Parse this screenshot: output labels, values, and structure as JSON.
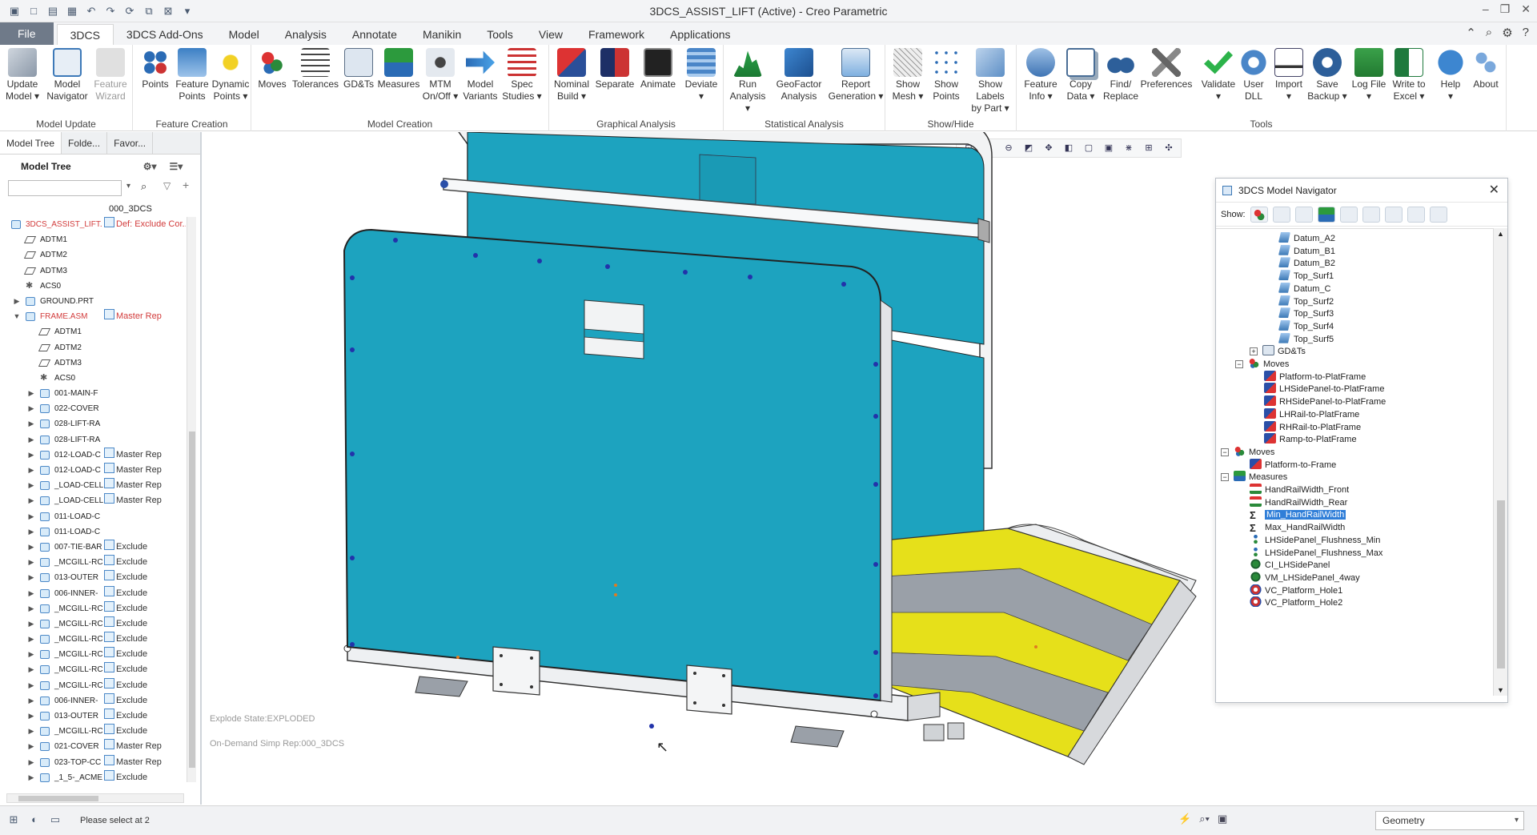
{
  "window": {
    "title": "3DCS_ASSIST_LIFT (Active) - Creo Parametric",
    "quick_access": [
      "app-icon",
      "new-icon",
      "open-icon",
      "save-icon",
      "undo-icon",
      "redo-icon",
      "regenerate-icon",
      "windows-icon",
      "close-window-icon",
      "customize-icon"
    ],
    "controls": [
      "minimize-icon",
      "restore-icon",
      "close-icon"
    ]
  },
  "tabs": [
    {
      "label": "File"
    },
    {
      "label": "3DCS"
    },
    {
      "label": "3DCS Add-Ons"
    },
    {
      "label": "Model"
    },
    {
      "label": "Analysis"
    },
    {
      "label": "Annotate"
    },
    {
      "label": "Manikin"
    },
    {
      "label": "Tools"
    },
    {
      "label": "View"
    },
    {
      "label": "Framework"
    },
    {
      "label": "Applications"
    }
  ],
  "ribbon": {
    "groups": [
      {
        "name": "Model Update",
        "buttons": [
          {
            "label": "Update\nModel ▾"
          },
          {
            "label": "Model\nNavigator"
          },
          {
            "label": "Feature\nWizard"
          }
        ]
      },
      {
        "name": "Feature Creation",
        "buttons": [
          {
            "label": "Points"
          },
          {
            "label": "Feature\nPoints"
          },
          {
            "label": "Dynamic\nPoints ▾"
          }
        ]
      },
      {
        "name": "Model Creation",
        "buttons": [
          {
            "label": "Moves"
          },
          {
            "label": "Tolerances"
          },
          {
            "label": "GD&Ts"
          },
          {
            "label": "Measures"
          },
          {
            "label": "MTM\nOn/Off ▾"
          },
          {
            "label": "Model\nVariants"
          },
          {
            "label": "Spec\nStudies ▾"
          }
        ]
      },
      {
        "name": "Graphical Analysis",
        "buttons": [
          {
            "label": "Nominal\nBuild ▾"
          },
          {
            "label": "Separate"
          },
          {
            "label": "Animate"
          },
          {
            "label": "Deviate\n▾"
          }
        ]
      },
      {
        "name": "Statistical Analysis",
        "buttons": [
          {
            "label": "Run\nAnalysis ▾"
          },
          {
            "label": "GeoFactor\nAnalysis"
          },
          {
            "label": "Report\nGeneration ▾"
          }
        ]
      },
      {
        "name": "Show/Hide",
        "buttons": [
          {
            "label": "Show\nMesh ▾"
          },
          {
            "label": "Show\nPoints"
          },
          {
            "label": "Show Labels\nby Part ▾"
          }
        ]
      },
      {
        "name": "Tools",
        "buttons": [
          {
            "label": "Feature\nInfo ▾"
          },
          {
            "label": "Copy\nData ▾"
          },
          {
            "label": "Find/\nReplace"
          },
          {
            "label": "Preferences"
          },
          {
            "label": "Validate\n▾"
          },
          {
            "label": "User\nDLL"
          },
          {
            "label": "Import\n▾"
          },
          {
            "label": "Save\nBackup ▾"
          },
          {
            "label": "Log File\n▾"
          },
          {
            "label": "Write to\nExcel ▾"
          },
          {
            "label": "Help\n▾"
          },
          {
            "label": "About"
          }
        ]
      }
    ]
  },
  "left_panel": {
    "tabs": [
      {
        "label": "Model Tree"
      },
      {
        "label": "Folde..."
      },
      {
        "label": "Favor..."
      }
    ],
    "header": "Model Tree",
    "column_header": "000_3DCS",
    "rows": [
      {
        "name": "3DCS_ASSIST_LIFT.",
        "rep": "Def: Exclude Cor...",
        "level": 0,
        "expand": "",
        "type": "asm",
        "red": true,
        "repred": true
      },
      {
        "name": "ADTM1",
        "rep": "",
        "level": 1,
        "expand": "",
        "type": "datum"
      },
      {
        "name": "ADTM2",
        "rep": "",
        "level": 1,
        "expand": "",
        "type": "datum"
      },
      {
        "name": "ADTM3",
        "rep": "",
        "level": 1,
        "expand": "",
        "type": "datum"
      },
      {
        "name": "ACS0",
        "rep": "",
        "level": 1,
        "expand": "",
        "type": "csys"
      },
      {
        "name": "GROUND.PRT",
        "rep": "",
        "level": 1,
        "expand": "▶",
        "type": "part"
      },
      {
        "name": "FRAME.ASM",
        "rep": "Master Rep",
        "level": 1,
        "expand": "▼",
        "type": "asm",
        "red": true,
        "repred": true
      },
      {
        "name": "ADTM1",
        "rep": "",
        "level": 2,
        "expand": "",
        "type": "datum"
      },
      {
        "name": "ADTM2",
        "rep": "",
        "level": 2,
        "expand": "",
        "type": "datum"
      },
      {
        "name": "ADTM3",
        "rep": "",
        "level": 2,
        "expand": "",
        "type": "datum"
      },
      {
        "name": "ACS0",
        "rep": "",
        "level": 2,
        "expand": "",
        "type": "csys"
      },
      {
        "name": "001-MAIN-F",
        "rep": "",
        "level": 2,
        "expand": "▶",
        "type": "part"
      },
      {
        "name": "022-COVER",
        "rep": "",
        "level": 2,
        "expand": "▶",
        "type": "part"
      },
      {
        "name": "028-LIFT-RA",
        "rep": "",
        "level": 2,
        "expand": "▶",
        "type": "part"
      },
      {
        "name": "028-LIFT-RA",
        "rep": "",
        "level": 2,
        "expand": "▶",
        "type": "part"
      },
      {
        "name": "012-LOAD-C",
        "rep": "Master Rep",
        "level": 2,
        "expand": "▶",
        "type": "part"
      },
      {
        "name": "012-LOAD-C",
        "rep": "Master Rep",
        "level": 2,
        "expand": "▶",
        "type": "part"
      },
      {
        "name": "_LOAD-CELL",
        "rep": "Master Rep",
        "level": 2,
        "expand": "▶",
        "type": "part"
      },
      {
        "name": "_LOAD-CELL",
        "rep": "Master Rep",
        "level": 2,
        "expand": "▶",
        "type": "part"
      },
      {
        "name": "011-LOAD-C",
        "rep": "",
        "level": 2,
        "expand": "▶",
        "type": "part"
      },
      {
        "name": "011-LOAD-C",
        "rep": "",
        "level": 2,
        "expand": "▶",
        "type": "part"
      },
      {
        "name": "007-TIE-BAR",
        "rep": "Exclude",
        "level": 2,
        "expand": "▶",
        "type": "part"
      },
      {
        "name": "_MCGILL-RC",
        "rep": "Exclude",
        "level": 2,
        "expand": "▶",
        "type": "part"
      },
      {
        "name": "013-OUTER",
        "rep": "Exclude",
        "level": 2,
        "expand": "▶",
        "type": "part"
      },
      {
        "name": "006-INNER-",
        "rep": "Exclude",
        "level": 2,
        "expand": "▶",
        "type": "part"
      },
      {
        "name": "_MCGILL-RC",
        "rep": "Exclude",
        "level": 2,
        "expand": "▶",
        "type": "part"
      },
      {
        "name": "_MCGILL-RC",
        "rep": "Exclude",
        "level": 2,
        "expand": "▶",
        "type": "part"
      },
      {
        "name": "_MCGILL-RC",
        "rep": "Exclude",
        "level": 2,
        "expand": "▶",
        "type": "part"
      },
      {
        "name": "_MCGILL-RC",
        "rep": "Exclude",
        "level": 2,
        "expand": "▶",
        "type": "part"
      },
      {
        "name": "_MCGILL-RC",
        "rep": "Exclude",
        "level": 2,
        "expand": "▶",
        "type": "part"
      },
      {
        "name": "_MCGILL-RC",
        "rep": "Exclude",
        "level": 2,
        "expand": "▶",
        "type": "part"
      },
      {
        "name": "006-INNER-",
        "rep": "Exclude",
        "level": 2,
        "expand": "▶",
        "type": "part"
      },
      {
        "name": "013-OUTER",
        "rep": "Exclude",
        "level": 2,
        "expand": "▶",
        "type": "part"
      },
      {
        "name": "_MCGILL-RC",
        "rep": "Exclude",
        "level": 2,
        "expand": "▶",
        "type": "part"
      },
      {
        "name": "021-COVER",
        "rep": "Master Rep",
        "level": 2,
        "expand": "▶",
        "type": "part"
      },
      {
        "name": "023-TOP-CC",
        "rep": "Master Rep",
        "level": 2,
        "expand": "▶",
        "type": "part"
      },
      {
        "name": "_1_5-_ACME",
        "rep": "Exclude",
        "level": 2,
        "expand": "▶",
        "type": "part"
      }
    ]
  },
  "viewport": {
    "explode_state": "Explode State:EXPLODED",
    "simp_rep": "On-Demand Simp Rep:000_3DCS",
    "toolbar": [
      "refit-icon",
      "zoom-in-icon",
      "zoom-out-icon",
      "repaint-icon",
      "pan-icon",
      "display-style-icon",
      "named-views-icon",
      "section-icon",
      "datum-display-icon",
      "annotation-display-icon",
      "spin-center-icon"
    ]
  },
  "navigator": {
    "title": "3DCS Model Navigator",
    "show_label": "Show:",
    "show_icons": 9,
    "rows": [
      {
        "label": "Datum_A2",
        "indent": 3,
        "icon": "plane",
        "expand": ""
      },
      {
        "label": "Datum_B1",
        "indent": 3,
        "icon": "plane",
        "expand": ""
      },
      {
        "label": "Datum_B2",
        "indent": 3,
        "icon": "plane",
        "expand": ""
      },
      {
        "label": "Top_Surf1",
        "indent": 3,
        "icon": "plane",
        "expand": ""
      },
      {
        "label": "Datum_C",
        "indent": 3,
        "icon": "plane",
        "expand": ""
      },
      {
        "label": "Top_Surf2",
        "indent": 3,
        "icon": "plane",
        "expand": ""
      },
      {
        "label": "Top_Surf3",
        "indent": 3,
        "icon": "plane",
        "expand": ""
      },
      {
        "label": "Top_Surf4",
        "indent": 3,
        "icon": "plane",
        "expand": ""
      },
      {
        "label": "Top_Surf5",
        "indent": 3,
        "icon": "plane",
        "expand": ""
      },
      {
        "label": "GD&Ts",
        "indent": 2,
        "icon": "gdt",
        "expand": "+"
      },
      {
        "label": "Moves",
        "indent": 1,
        "icon": "moves",
        "expand": "−"
      },
      {
        "label": "Platform-to-PlatFrame",
        "indent": 2,
        "icon": "move",
        "expand": ""
      },
      {
        "label": "LHSidePanel-to-PlatFrame",
        "indent": 2,
        "icon": "move",
        "expand": ""
      },
      {
        "label": "RHSidePanel-to-PlatFrame",
        "indent": 2,
        "icon": "move",
        "expand": ""
      },
      {
        "label": "LHRail-to-PlatFrame",
        "indent": 2,
        "icon": "move",
        "expand": ""
      },
      {
        "label": "RHRail-to-PlatFrame",
        "indent": 2,
        "icon": "move",
        "expand": ""
      },
      {
        "label": "Ramp-to-PlatFrame",
        "indent": 2,
        "icon": "move",
        "expand": ""
      },
      {
        "label": "Moves",
        "indent": 0,
        "icon": "moves",
        "expand": "−"
      },
      {
        "label": "Platform-to-Frame",
        "indent": 1,
        "icon": "move",
        "expand": ""
      },
      {
        "label": "Measures",
        "indent": 0,
        "icon": "measures",
        "expand": "−"
      },
      {
        "label": "HandRailWidth_Front",
        "indent": 1,
        "icon": "measure",
        "expand": ""
      },
      {
        "label": "HandRailWidth_Rear",
        "indent": 1,
        "icon": "measure",
        "expand": ""
      },
      {
        "label": "Min_HandRailWidth",
        "indent": 1,
        "icon": "sigma",
        "expand": "",
        "selected": true
      },
      {
        "label": "Max_HandRailWidth",
        "indent": 1,
        "icon": "sigma",
        "expand": ""
      },
      {
        "label": "LHSidePanel_Flushness_Min",
        "indent": 1,
        "icon": "dots",
        "expand": ""
      },
      {
        "label": "LHSidePanel_Flushness_Max",
        "indent": 1,
        "icon": "dots",
        "expand": ""
      },
      {
        "label": "CI_LHSidePanel",
        "indent": 1,
        "icon": "ci",
        "expand": ""
      },
      {
        "label": "VM_LHSidePanel_4way",
        "indent": 1,
        "icon": "ci",
        "expand": ""
      },
      {
        "label": "VC_Platform_Hole1",
        "indent": 1,
        "icon": "vc",
        "expand": ""
      },
      {
        "label": "VC_Platform_Hole2",
        "indent": 1,
        "icon": "vc",
        "expand": ""
      }
    ]
  },
  "statusbar": {
    "message": "Please select at 2",
    "filter": "Geometry"
  },
  "colors": {
    "panel_teal": "#1da3bf",
    "ramp_yellow": "#e6e01a",
    "ramp_gray": "#9aa0a8",
    "selection_blue": "#2f7ed8"
  }
}
